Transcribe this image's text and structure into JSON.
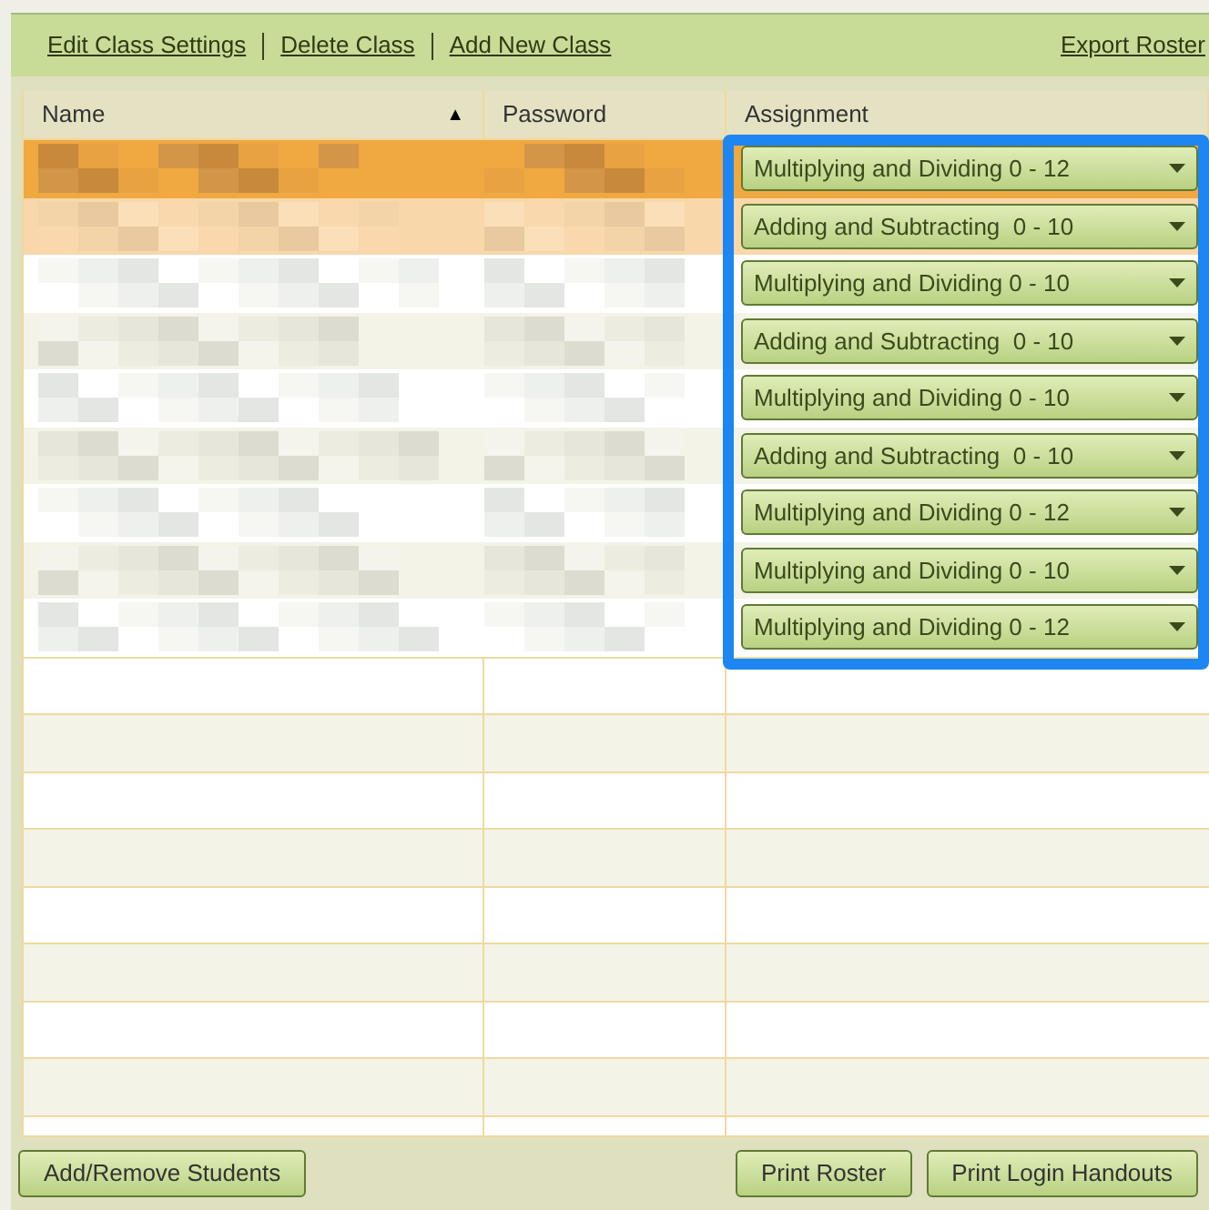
{
  "toolbar": {
    "links": [
      "Edit Class Settings",
      "Delete Class",
      "Add New Class"
    ],
    "export_link": "Export Roster"
  },
  "table": {
    "columns": [
      {
        "label": "Name",
        "sort_indicator": "▲"
      },
      {
        "label": "Password"
      },
      {
        "label": "Assignment"
      }
    ],
    "rows": [
      {
        "selected": true,
        "hovered": false,
        "assignment": "Multiplying and Dividing 0 - 12"
      },
      {
        "selected": false,
        "hovered": true,
        "assignment": "Adding and Subtracting  0 - 10"
      },
      {
        "selected": false,
        "hovered": false,
        "assignment": "Multiplying and Dividing 0 - 10"
      },
      {
        "selected": false,
        "hovered": false,
        "assignment": "Adding and Subtracting  0 - 10"
      },
      {
        "selected": false,
        "hovered": false,
        "assignment": "Multiplying and Dividing 0 - 10"
      },
      {
        "selected": false,
        "hovered": false,
        "assignment": "Adding and Subtracting  0 - 10"
      },
      {
        "selected": false,
        "hovered": false,
        "assignment": "Multiplying and Dividing 0 - 12"
      },
      {
        "selected": false,
        "hovered": false,
        "assignment": "Multiplying and Dividing 0 - 10"
      },
      {
        "selected": false,
        "hovered": false,
        "assignment": "Multiplying and Dividing 0 - 12"
      }
    ]
  },
  "buttons_left": [
    "Add/Remove Students"
  ],
  "buttons_right": [
    "Print Roster",
    "Print Login Handouts"
  ]
}
